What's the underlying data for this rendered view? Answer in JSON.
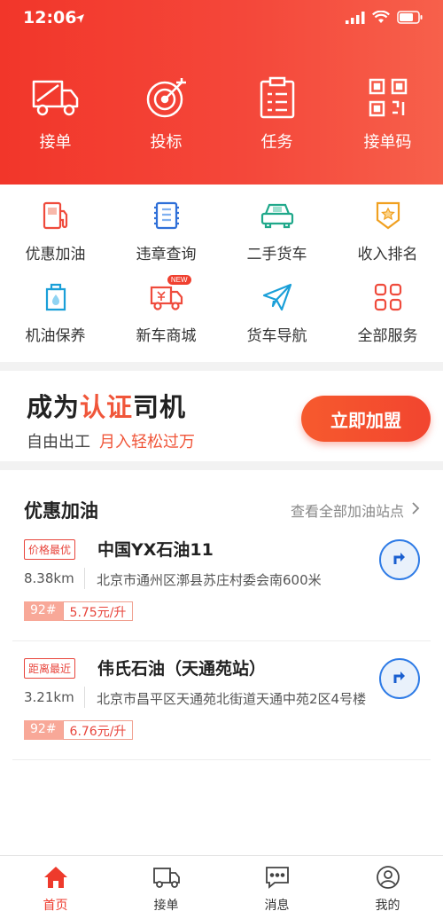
{
  "status": {
    "time": "12:06"
  },
  "top_actions": [
    {
      "label": "接单",
      "icon": "truck-icon"
    },
    {
      "label": "投标",
      "icon": "target-icon"
    },
    {
      "label": "任务",
      "icon": "task-list-icon"
    },
    {
      "label": "接单码",
      "icon": "qr-code-icon"
    }
  ],
  "services": [
    {
      "label": "优惠加油",
      "icon": "fuel-pump-icon"
    },
    {
      "label": "违章查询",
      "icon": "document-icon"
    },
    {
      "label": "二手货车",
      "icon": "car-icon"
    },
    {
      "label": "收入排名",
      "icon": "ranking-badge-icon"
    },
    {
      "label": "机油保养",
      "icon": "oil-can-icon"
    },
    {
      "label": "新车商城",
      "icon": "new-truck-icon",
      "badge": "NEW"
    },
    {
      "label": "货车导航",
      "icon": "navigation-plane-icon"
    },
    {
      "label": "全部服务",
      "icon": "grid-icon"
    }
  ],
  "banner": {
    "title_prefix": "成为",
    "title_highlight": "认证",
    "title_suffix": "司机",
    "subtitle": "自由出工",
    "subtitle_highlight": "月入轻松过万",
    "button": "立即加盟"
  },
  "fuel": {
    "title": "优惠加油",
    "more": "查看全部加油站点",
    "stations": [
      {
        "tag": "价格最优",
        "name": "中国YX石油11",
        "distance": "8.38km",
        "address": "北京市通州区漷县苏庄村委会南600米",
        "grade": "92#",
        "price": "5.75元/升"
      },
      {
        "tag": "距离最近",
        "name": "伟氏石油（天通苑站）",
        "distance": "3.21km",
        "address": "北京市昌平区天通苑北街道天通中苑2区4号楼",
        "grade": "92#",
        "price": "6.76元/升"
      }
    ]
  },
  "tabs": [
    {
      "label": "首页",
      "icon": "home-icon",
      "active": true
    },
    {
      "label": "接单",
      "icon": "truck-icon",
      "active": false
    },
    {
      "label": "消息",
      "icon": "message-icon",
      "active": false
    },
    {
      "label": "我的",
      "icon": "user-icon",
      "active": false
    }
  ],
  "colors": {
    "primary": "#f2362a",
    "accent": "#f0563a",
    "nav_blue": "#2e7be6"
  }
}
